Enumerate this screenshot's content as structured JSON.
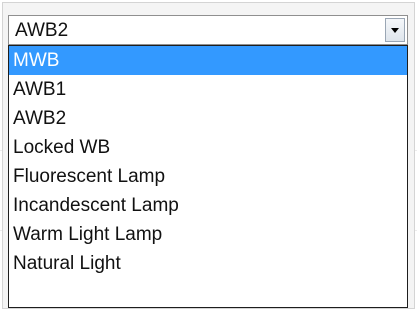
{
  "select": {
    "value": "AWB2",
    "arrow_icon": "chevron-down-icon"
  },
  "dropdown": {
    "highlighted_index": 0,
    "options": [
      {
        "label": "MWB"
      },
      {
        "label": "AWB1"
      },
      {
        "label": "AWB2"
      },
      {
        "label": "Locked WB"
      },
      {
        "label": "Fluorescent Lamp"
      },
      {
        "label": "Incandescent Lamp"
      },
      {
        "label": "Warm Light Lamp"
      },
      {
        "label": "Natural Light"
      }
    ]
  },
  "colors": {
    "highlight": "#3399ff",
    "highlight_text": "#ffffff",
    "border": "#8f8f8f"
  }
}
